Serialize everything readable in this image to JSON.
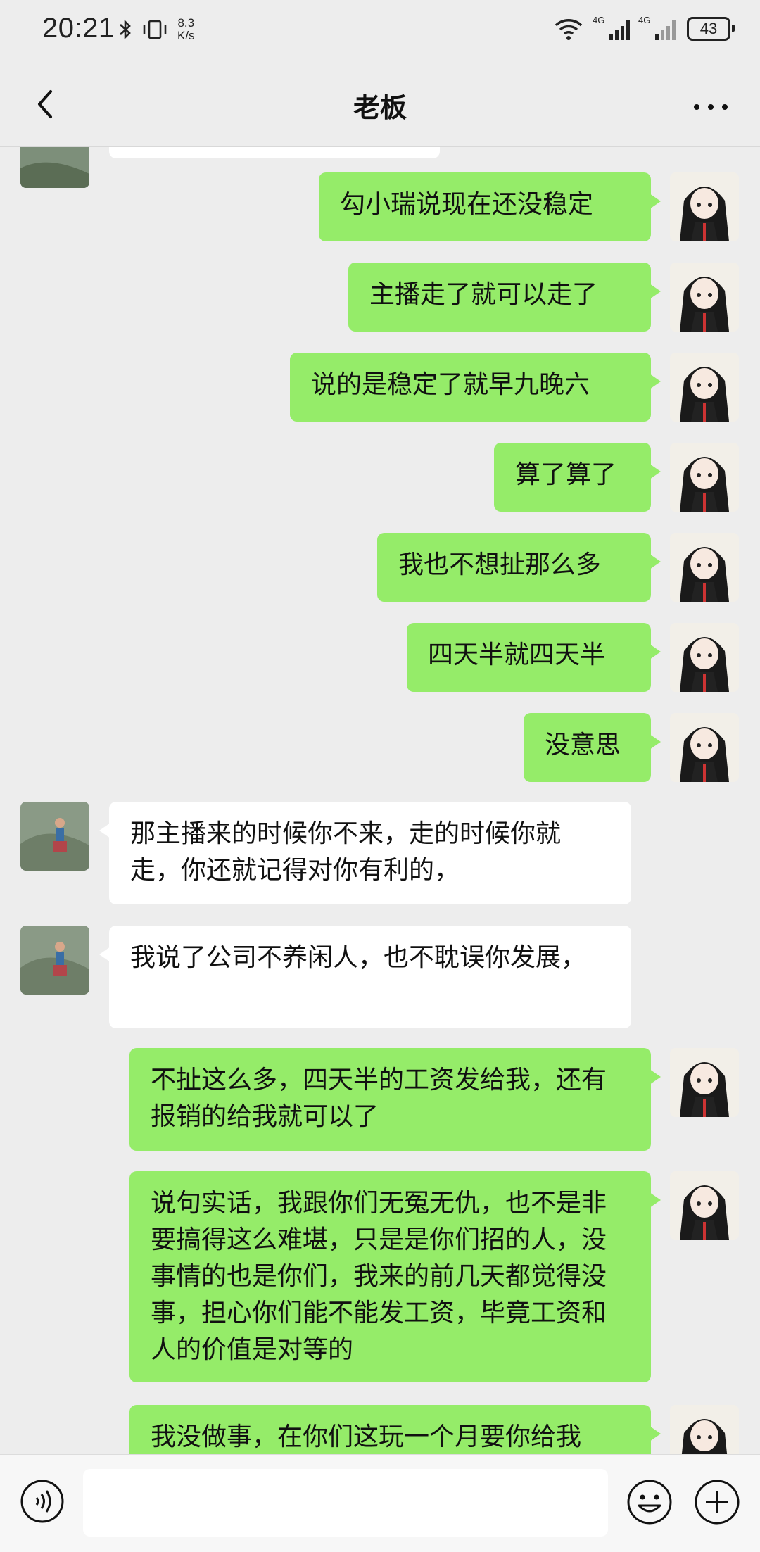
{
  "status_bar": {
    "time": "20:21",
    "net_speed_value": "8.3",
    "net_speed_unit": "K/s",
    "signal1": "4G",
    "signal2": "4G",
    "battery": "43"
  },
  "header": {
    "title": "老板"
  },
  "messages": [
    {
      "from": "me",
      "text": "勾小瑞说现在还没稳定"
    },
    {
      "from": "me",
      "text": "主播走了就可以走了"
    },
    {
      "from": "me",
      "text": "说的是稳定了就早九晚六"
    },
    {
      "from": "me",
      "text": "算了算了"
    },
    {
      "from": "me",
      "text": "我也不想扯那么多"
    },
    {
      "from": "me",
      "text": "四天半就四天半"
    },
    {
      "from": "me",
      "text": "没意思"
    },
    {
      "from": "them",
      "text": "那主播来的时候你不来，走的时候你就走，你还就记得对你有利的，"
    },
    {
      "from": "them",
      "text": "我说了公司不养闲人，也不耽误你发展，"
    },
    {
      "from": "me",
      "text": "不扯这么多，四天半的工资发给我，还有报销的给我就可以了"
    },
    {
      "from": "me",
      "text": "说句实话，我跟你们无冤无仇，也不是非要搞得这么难堪，只是是你们招的人，没事情的也是你们，我来的前几天都觉得没事，担心你们能不能发工资，毕竟工资和人的价值是对等的"
    },
    {
      "from": "me",
      "text": "我没做事，在你们这玩一个月要你给我"
    }
  ],
  "input": {
    "placeholder": ""
  },
  "colors": {
    "me_bubble": "#95ec69",
    "them_bubble": "#ffffff",
    "background": "#ededed"
  }
}
